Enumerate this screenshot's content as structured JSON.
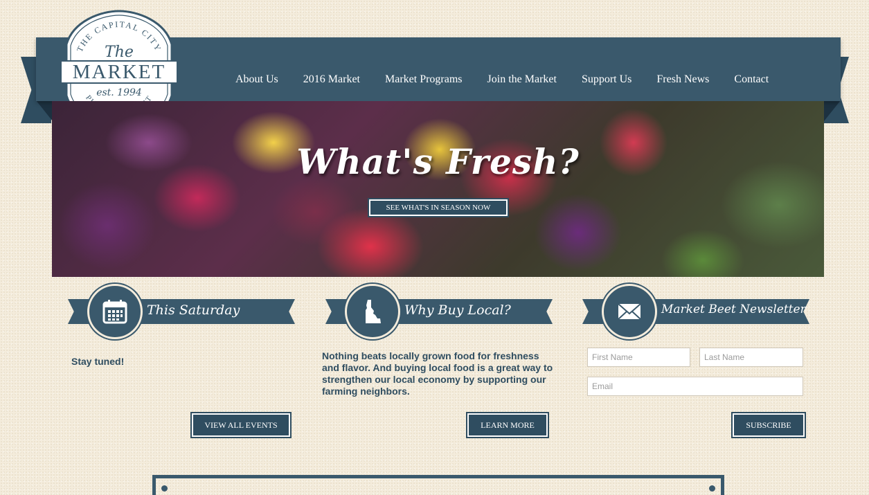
{
  "logo": {
    "top_arc": "THE CAPITAL CITY",
    "the": "The",
    "market": "MARKET",
    "est": "est. 1994",
    "bottom_arc": "PUBLIC MARKET"
  },
  "nav": {
    "items": [
      {
        "label": "About Us"
      },
      {
        "label": "2016 Market"
      },
      {
        "label": "Market Programs"
      },
      {
        "label": "Join the Market"
      },
      {
        "label": "Support Us"
      },
      {
        "label": "Fresh News"
      },
      {
        "label": "Contact"
      }
    ]
  },
  "hero": {
    "title": "What's Fresh?",
    "button": "SEE WHAT'S IN SEASON NOW"
  },
  "sections": {
    "saturday": {
      "title": "This Saturday",
      "text": "Stay tuned!",
      "button": "VIEW ALL EVENTS"
    },
    "local": {
      "title": "Why Buy Local?",
      "text": "Nothing beats locally grown food for freshness and flavor. And buying local food is a great way to strengthen our local economy by supporting our farming neighbors.",
      "button": "LEARN MORE"
    },
    "newsletter": {
      "title": "Market Beet Newsletter",
      "first_name_placeholder": "First Name",
      "last_name_placeholder": "Last Name",
      "email_placeholder": "Email",
      "button": "SUBSCRIBE"
    }
  },
  "colors": {
    "primary": "#3a596c",
    "background": "#f4ecdc",
    "text": "#2f4d60"
  }
}
